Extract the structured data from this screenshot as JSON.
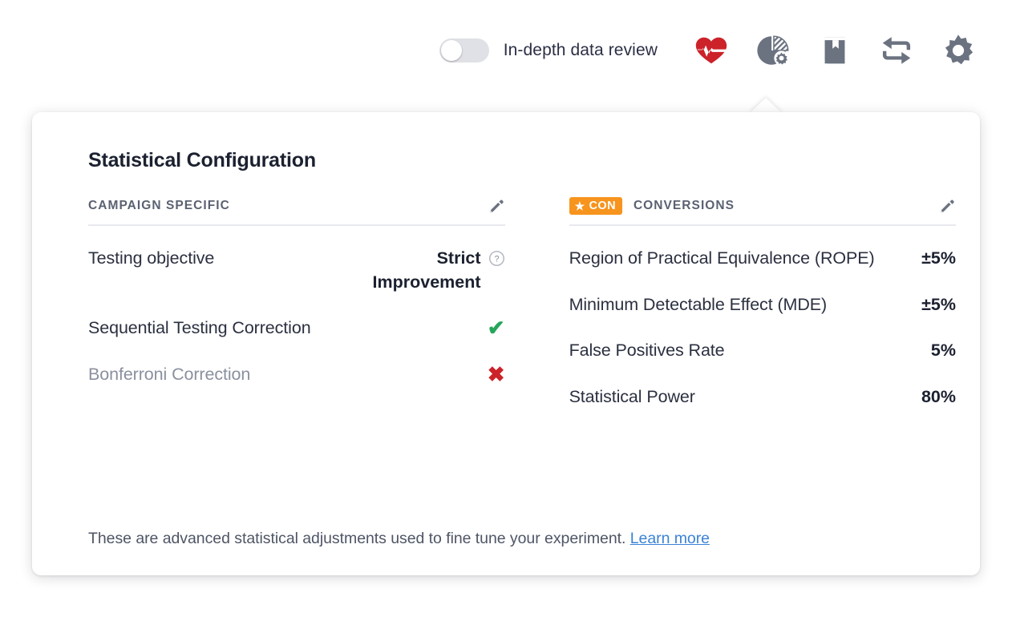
{
  "toolbar": {
    "toggle": {
      "label": "In-depth data review",
      "state": "off"
    },
    "icons": [
      {
        "name": "heart-pulse-icon",
        "color": "#cc2229"
      },
      {
        "name": "pie-chart-gear-icon",
        "color": "#6b7280"
      },
      {
        "name": "book-icon",
        "color": "#6b7280"
      },
      {
        "name": "sync-refresh-icon",
        "color": "#6b7280"
      },
      {
        "name": "gear-icon",
        "color": "#6b7280"
      }
    ]
  },
  "card": {
    "title": "Statistical Configuration",
    "left_column": {
      "heading": "CAMPAIGN SPECIFIC",
      "edit_icon": "pencil-icon",
      "rows": [
        {
          "label": "Testing objective",
          "value": "Strict Improvement",
          "help": "?",
          "muted": false
        },
        {
          "label": "Sequential Testing Correction",
          "value": "✔",
          "status": "enabled",
          "muted": false
        },
        {
          "label": "Bonferroni Correction",
          "value": "✖",
          "status": "disabled",
          "muted": true
        }
      ]
    },
    "right_column": {
      "badge": {
        "star": "★",
        "text": "CON",
        "color": "#f7941d"
      },
      "heading": "CONVERSIONS",
      "edit_icon": "pencil-icon",
      "rows": [
        {
          "label": "Region of Practical Equivalence (ROPE)",
          "value": "±5%"
        },
        {
          "label": "Minimum Detectable Effect (MDE)",
          "value": "±5%"
        },
        {
          "label": "False Positives Rate",
          "value": "5%"
        },
        {
          "label": "Statistical Power",
          "value": "80%"
        }
      ]
    },
    "footer": {
      "text": "These are advanced statistical adjustments used to fine tune your experiment.",
      "link": "Learn more"
    }
  }
}
